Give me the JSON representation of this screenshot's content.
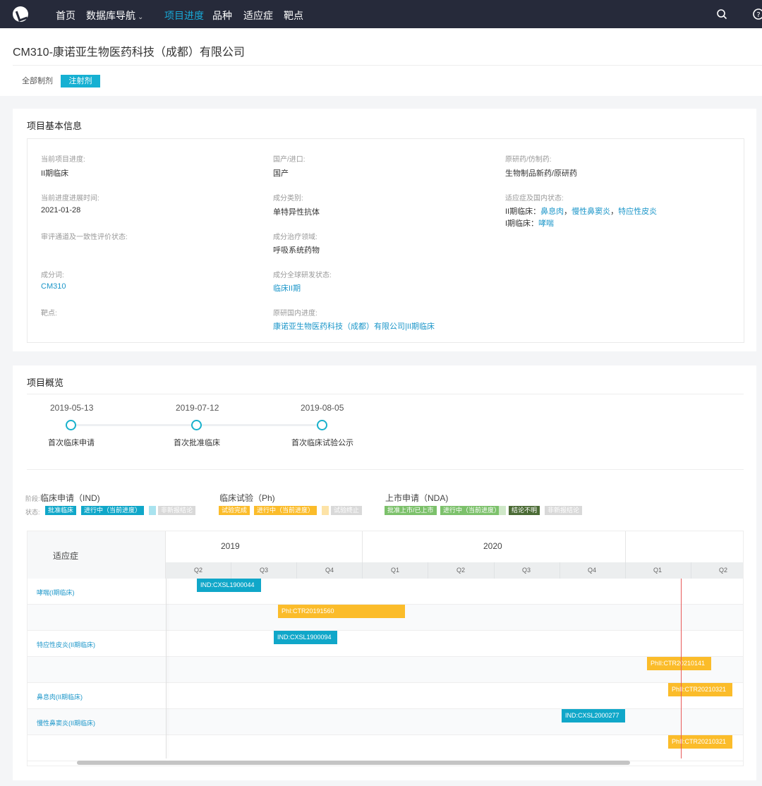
{
  "nav": {
    "items": [
      "首页",
      "数据库导航",
      "项目进度",
      "品种",
      "适应症",
      "靶点"
    ],
    "active": "项目进度"
  },
  "header": {
    "title": "CM310-康诺亚生物医药科技（成都）有限公司",
    "tabs": [
      "全部制剂",
      "注射剂"
    ],
    "selected_tab": "注射剂"
  },
  "basic_info": {
    "title": "项目基本信息",
    "fields": {
      "current_phase": {
        "label": "当前项目进度:",
        "value": "II期临床"
      },
      "domestic_import": {
        "label": "国产/进口:",
        "value": "国产"
      },
      "original_generic": {
        "label": "原研药/仿制药:",
        "value": "生物制品新药/原研药"
      },
      "progress_time": {
        "label": "当前进度进展时间:",
        "value": "2021-01-28"
      },
      "component_type": {
        "label": "成分类别:",
        "value": "单特异性抗体"
      },
      "indication_status": {
        "label": "适应症及国内状态:"
      },
      "review_channel": {
        "label": "审评通道及一致性评价状态:"
      },
      "therapeutic_area": {
        "label": "成分治疗领域:",
        "value": "呼吸系统药物"
      },
      "ingredient": {
        "label": "成分词:",
        "value": "CM310"
      },
      "global_status": {
        "label": "成分全球研发状态:",
        "value": "临床II期"
      },
      "target": {
        "label": "靶点:"
      },
      "original_domestic": {
        "label": "原研国内进度:",
        "value": "康诺亚生物医药科技（成都）有限公司|II期临床"
      }
    },
    "indication_lines": [
      {
        "prefix": "II期临床：",
        "items": [
          "鼻息肉",
          "慢性鼻窦炎",
          "特应性皮炎"
        ]
      },
      {
        "prefix": "I期临床：",
        "items": [
          "哮喘"
        ]
      }
    ]
  },
  "overview": {
    "title": "项目概览",
    "milestones": [
      {
        "date": "2019-05-13",
        "label": "首次临床申请"
      },
      {
        "date": "2019-07-12",
        "label": "首次批准临床"
      },
      {
        "date": "2019-08-05",
        "label": "首次临床试验公示"
      }
    ],
    "legend": {
      "stage_label": "阶段:",
      "status_label": "状态:",
      "stages": [
        "临床申请（IND)",
        "临床试验（Ph)",
        "上市申请（NDA)"
      ],
      "ind_chips": [
        {
          "text": "批准临床",
          "color": "#10a7c9"
        },
        {
          "text": "进行中（当前进度）",
          "color": "#10a7c9"
        },
        {
          "text": "",
          "color": "#a9e3ef"
        },
        {
          "text": "非新报结论",
          "color": "#d9d9d9"
        }
      ],
      "ph_chips": [
        {
          "text": "试验完成",
          "color": "#fbbc2a"
        },
        {
          "text": "进行中（当前进度）",
          "color": "#fbbc2a"
        },
        {
          "text": "",
          "color": "#fde3a7"
        },
        {
          "text": "试验终止",
          "color": "#d9d9d9"
        }
      ],
      "nda_chips": [
        {
          "text": "批准上市/已上市",
          "color": "#7cc16b"
        },
        {
          "text": "进行中（当前进度）",
          "color": "#7cc16b"
        },
        {
          "text": "",
          "color": "#cfe8c8"
        },
        {
          "text": "结论不明",
          "color": "#4b6b35"
        },
        {
          "text": "非新报结论",
          "color": "#d9d9d9"
        }
      ]
    },
    "gantt": {
      "indication_header": "适应症",
      "years": [
        "2019",
        "2020"
      ],
      "quarters": [
        "Q2",
        "Q3",
        "Q4",
        "Q1",
        "Q2",
        "Q3",
        "Q4",
        "Q1",
        "Q2"
      ],
      "rows": [
        {
          "label": "哮喘(I期临床)",
          "bars": [
            {
              "type": "ind",
              "text": "IND:CXSL1900044"
            }
          ]
        },
        {
          "label": "",
          "bars": [
            {
              "type": "ph",
              "text": "PhI:CTR20191560"
            }
          ]
        },
        {
          "label": "特应性皮炎(II期临床)",
          "bars": [
            {
              "type": "ind",
              "text": "IND:CXSL1900094"
            }
          ]
        },
        {
          "label": "",
          "bars": [
            {
              "type": "ph",
              "text": "PhII:CTR20210141"
            }
          ]
        },
        {
          "label": "鼻息肉(II期临床)",
          "bars": [
            {
              "type": "ph",
              "text": "PhII:CTR20210321"
            }
          ]
        },
        {
          "label": "慢性鼻窦炎(II期临床)",
          "bars": [
            {
              "type": "ind",
              "text": "IND:CXSL2000277"
            }
          ]
        },
        {
          "label": "",
          "bars": [
            {
              "type": "ph",
              "text": "PhII:CTR20210321"
            }
          ]
        }
      ]
    }
  }
}
